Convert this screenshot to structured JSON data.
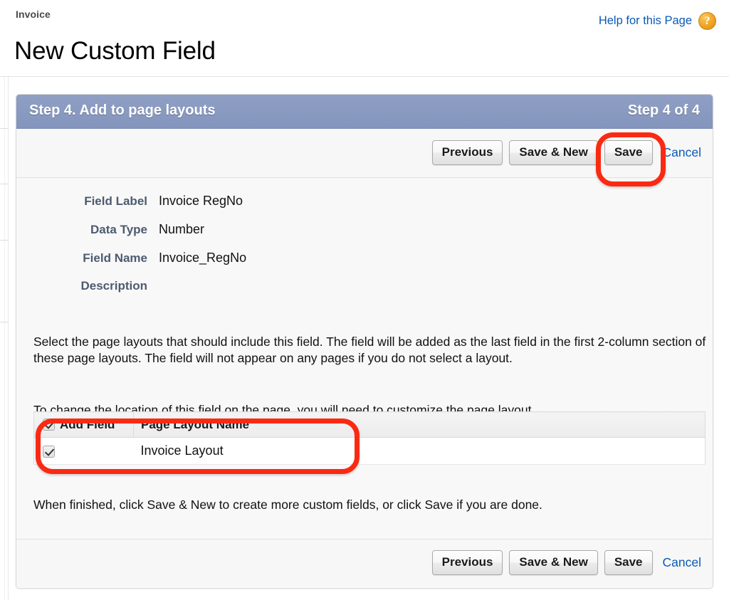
{
  "header": {
    "breadcrumb": "Invoice",
    "title": "New Custom Field",
    "help_label": "Help for this Page",
    "help_icon_glyph": "?"
  },
  "step": {
    "title": "Step 4. Add to page layouts",
    "counter": "Step 4 of 4",
    "bar_color": "#8a9ac2"
  },
  "buttons": {
    "previous": "Previous",
    "save_and_new": "Save & New",
    "save": "Save",
    "cancel": "Cancel"
  },
  "details": [
    {
      "label": "Field Label",
      "value": "Invoice RegNo"
    },
    {
      "label": "Data Type",
      "value": "Number"
    },
    {
      "label": "Field Name",
      "value": "Invoice_RegNo"
    },
    {
      "label": "Description",
      "value": ""
    }
  ],
  "paragraphs": {
    "intro": "Select the page layouts that should include this field. The field will be added as the last field in the first 2-column section of these page layouts. The field will not appear on any pages if you do not select a layout.",
    "relocate": "To change the location of this field on the page, you will need to customize the page layout.",
    "finish": "When finished, click Save & New to create more custom fields, or click Save if you are done."
  },
  "layout_table": {
    "columns": [
      "Add Field",
      "Page Layout Name"
    ],
    "header_checkbox_checked": true,
    "rows": [
      {
        "checked": true,
        "name": "Invoice Layout"
      }
    ]
  },
  "annotations": {
    "color": "#fa2a12",
    "targets": [
      "save-button-top",
      "page-layout-table"
    ]
  }
}
